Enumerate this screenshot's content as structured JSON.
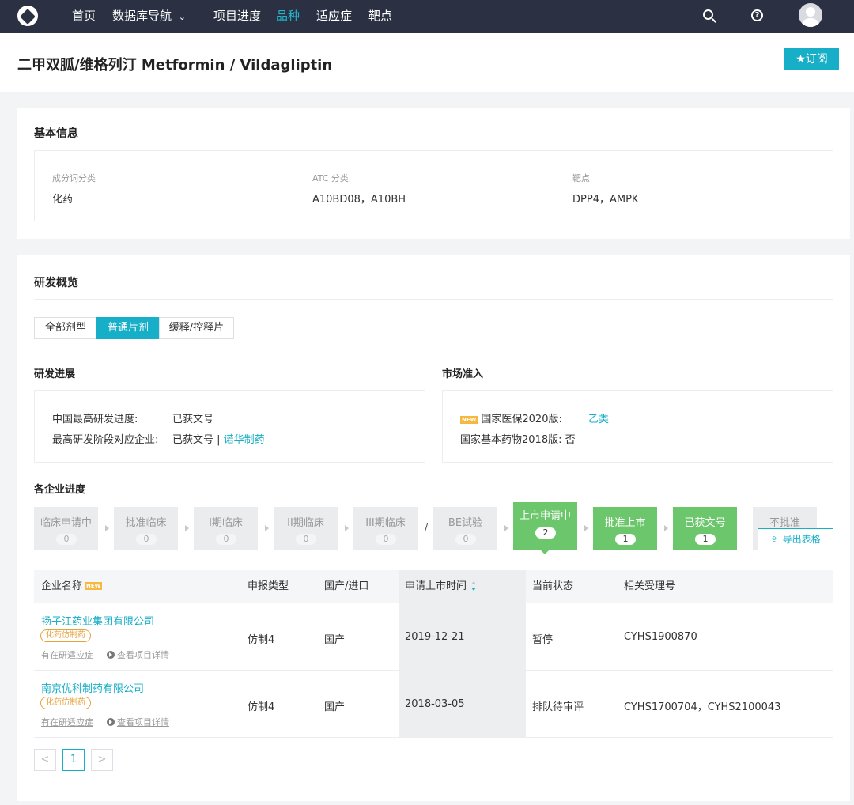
{
  "nav": {
    "items": [
      "首页",
      "数据库导航",
      "项目进度",
      "品种",
      "适应症",
      "靶点"
    ],
    "dropdown_caret": "⌄"
  },
  "header": {
    "title": "二甲双胍/维格列汀 Metformin / Vildagliptin",
    "subscribe_label": "★订阅"
  },
  "basic_info": {
    "title": "基本信息",
    "fields": [
      {
        "label": "成分词分类",
        "value": "化药"
      },
      {
        "label": "ATC 分类",
        "value": "A10BD08，A10BH"
      },
      {
        "label": "靶点",
        "value": "DPP4，AMPK"
      }
    ]
  },
  "rd": {
    "title": "研发概览",
    "tabs": [
      "全部剂型",
      "普通片剂",
      "缓释/控释片"
    ],
    "progress": {
      "title": "研发进展",
      "rows": [
        {
          "label": "中国最高研发进度:",
          "value": "已获文号"
        },
        {
          "label": "最高研发阶段对应企业:",
          "value": "已获文号 | ",
          "link": "诺华制药"
        }
      ]
    },
    "market": {
      "title": "市场准入",
      "badge": "NEW",
      "rows": [
        {
          "label": "国家医保2020版:",
          "value": "乙类"
        },
        {
          "label": "国家基本药物2018版:",
          "value": "否"
        }
      ]
    }
  },
  "pipeline": {
    "title": "各企业进度",
    "stages": [
      {
        "name": "临床申请中",
        "count": "0",
        "active": false
      },
      {
        "name": "批准临床",
        "count": "0",
        "active": false
      },
      {
        "name": "I期临床",
        "count": "0",
        "active": false
      },
      {
        "name": "II期临床",
        "count": "0",
        "active": false
      },
      {
        "name": "III期临床",
        "count": "0",
        "active": false
      },
      {
        "name": "BE试验",
        "count": "0",
        "active": false
      },
      {
        "name": "上市申请中",
        "count": "2",
        "active": true
      },
      {
        "name": "批准上市",
        "count": "1",
        "active": true
      },
      {
        "name": "已获文号",
        "count": "1",
        "active": true
      },
      {
        "name": "不批准",
        "count": "",
        "active": false
      }
    ],
    "slash": "/",
    "export_label": "导出表格"
  },
  "table": {
    "headers": [
      "企业名称",
      "申报类型",
      "国产/进口",
      "申请上市时间",
      "当前状态",
      "相关受理号"
    ],
    "new_badge": "NEW",
    "rows": [
      {
        "company": "扬子江药业集团有限公司",
        "tag": "化药仿制药",
        "link1": "有在研适应症",
        "link2": "查看项目详情",
        "type": "仿制4",
        "origin": "国产",
        "date": "2019-12-21",
        "status": "暂停",
        "accept": "CYHS1900870"
      },
      {
        "company": "南京优科制药有限公司",
        "tag": "化药仿制药",
        "link1": "有在研适应症",
        "link2": "查看项目详情",
        "type": "仿制4",
        "origin": "国产",
        "date": "2018-03-05",
        "status": "排队待审评",
        "accept": "CYHS1700704，CYHS2100043"
      }
    ]
  },
  "pager": {
    "prev": "<",
    "current": "1",
    "next": ">"
  },
  "colors": {
    "accent": "#17aec7",
    "nav_bg": "#2b3142",
    "stage_active": "#6cc76c"
  }
}
